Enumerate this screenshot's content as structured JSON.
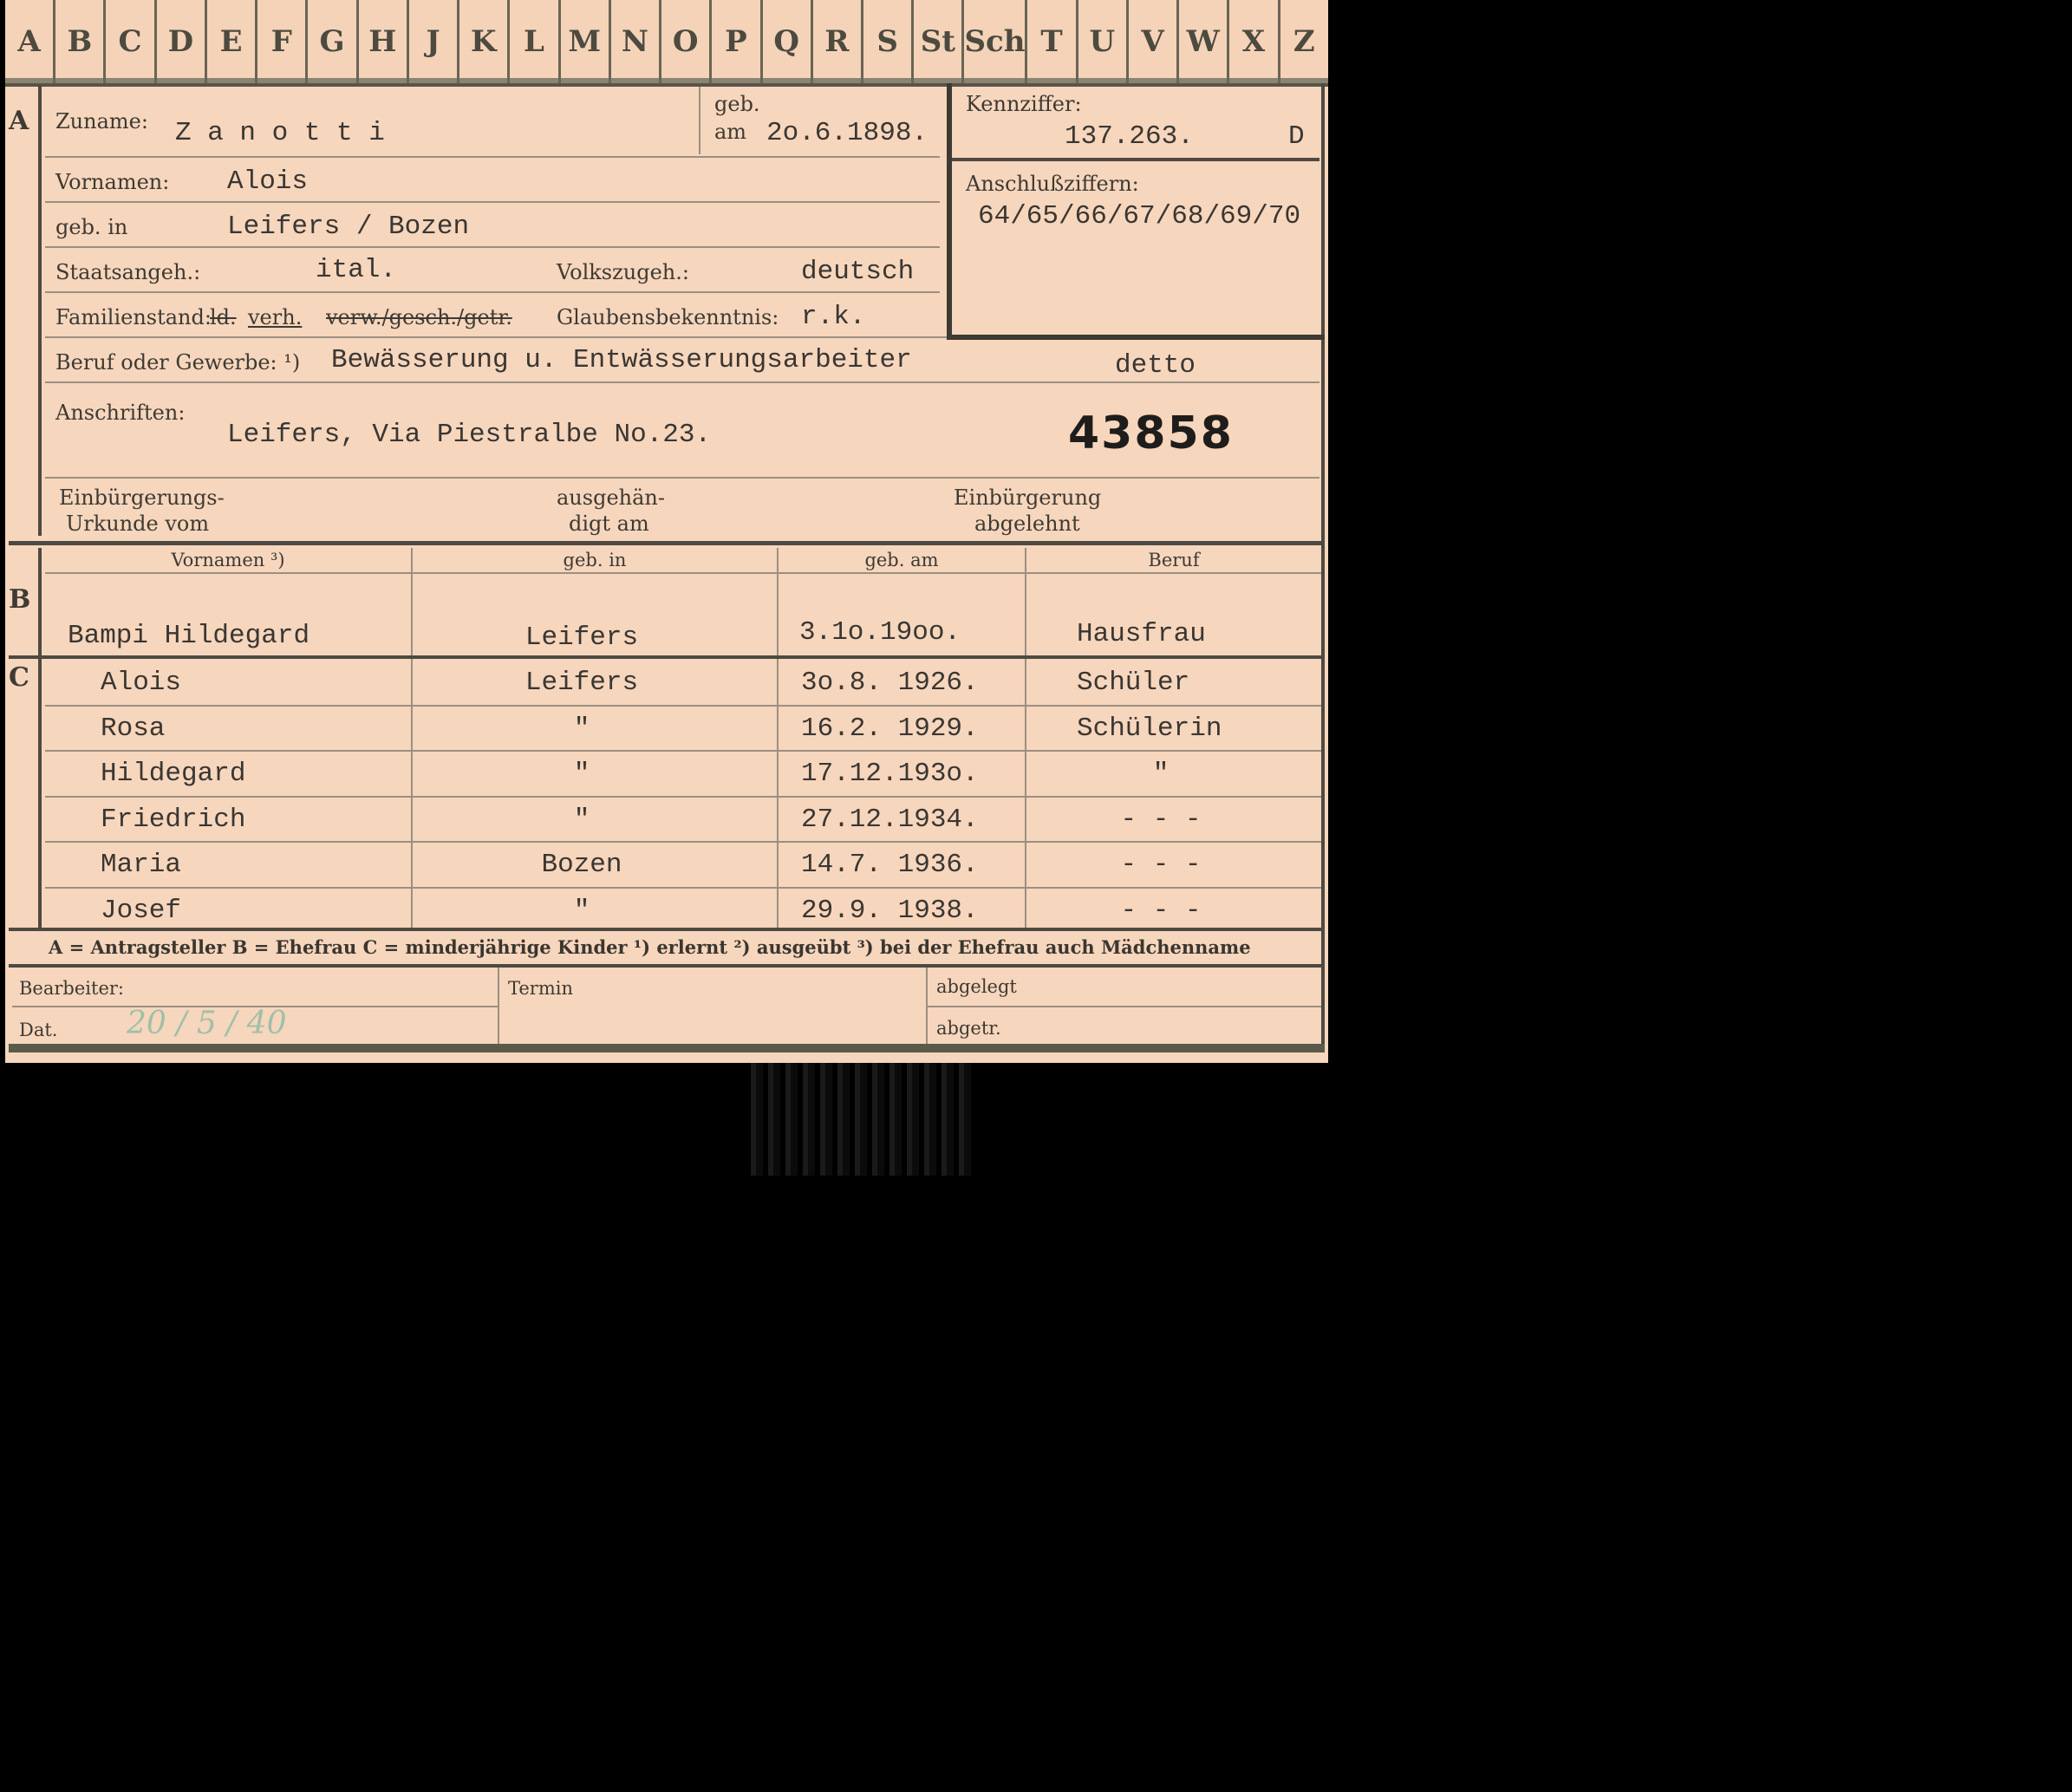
{
  "tabs": [
    "A",
    "B",
    "C",
    "D",
    "E",
    "F",
    "G",
    "H",
    "J",
    "K",
    "L",
    "M",
    "N",
    "O",
    "P",
    "Q",
    "R",
    "S",
    "St",
    "Sch",
    "T",
    "U",
    "V",
    "W",
    "X",
    "Z"
  ],
  "sections": {
    "a": "A",
    "b": "B",
    "c": "C"
  },
  "applicant": {
    "zuname_label": "Zuname:",
    "zuname": "Z a n o t t i",
    "geb_label": "geb.",
    "am_label": "am",
    "geb_am": "2o.6.1898.",
    "vornamen_label": "Vornamen:",
    "vornamen": "Alois",
    "geb_in_label": "geb. in",
    "geb_in": "Leifers / Bozen",
    "staatsangeh_label": "Staatsangeh.:",
    "staatsangeh": "ital.",
    "volkszugeh_label": "Volkszugeh.:",
    "volkszugeh": "deutsch",
    "familienstand_label": "Familienstand:",
    "familienstand_struck_1": "ld.",
    "familienstand_value": "verh.",
    "familienstand_struck_2": "verw./gesch./getr.",
    "glauben_label": "Glaubensbekenntnis:",
    "glauben": "r.k.",
    "beruf_label": "Beruf oder Gewerbe: ¹)",
    "beruf": "Bewässerung u. Entwässerungsarbeiter",
    "beruf_2": "detto",
    "anschriften_label": "Anschriften:",
    "anschrift": "Leifers, Via Piestralbe No.23.",
    "number": "43858",
    "einb_urkunde_label_1": "Einbürgerungs-",
    "einb_urkunde_label_2": "Urkunde vom",
    "ausgehaendigt_label_1": "ausgehän-",
    "ausgehaendigt_label_2": "digt am",
    "einb_abgelehnt_label_1": "Einbürgerung",
    "einb_abgelehnt_label_2": "abgelehnt"
  },
  "kennziffer": {
    "label": "Kennziffer:",
    "value": "137.263.",
    "suffix": "D",
    "anschluss_label": "Anschlußziffern:",
    "anschluss_value": "64/65/66/67/68/69/70"
  },
  "table": {
    "headers": [
      "Vornamen ³)",
      "geb. in",
      "geb. am",
      "Beruf"
    ],
    "wife": {
      "name": "Bampi Hildegard",
      "born_in": "Leifers",
      "born_on": "3.1o.19oo.",
      "job": "Hausfrau"
    },
    "children": [
      {
        "name": "Alois",
        "born_in": "Leifers",
        "born_on": "3o.8. 1926.",
        "job": "Schüler"
      },
      {
        "name": "Rosa",
        "born_in": "\"",
        "born_on": "16.2. 1929.",
        "job": "Schülerin"
      },
      {
        "name": "Hildegard",
        "born_in": "\"",
        "born_on": "17.12.193o.",
        "job": "\""
      },
      {
        "name": "Friedrich",
        "born_in": "\"",
        "born_on": "27.12.1934.",
        "job": "- - -"
      },
      {
        "name": "Maria",
        "born_in": "Bozen",
        "born_on": "14.7. 1936.",
        "job": "- - -"
      },
      {
        "name": "Josef",
        "born_in": "\"",
        "born_on": "29.9. 1938.",
        "job": "- - -"
      }
    ]
  },
  "legend": "A = Antragsteller   B = Ehefrau   C = minderjährige Kinder   ¹) erlernt   ²) ausgeübt   ³) bei der Ehefrau auch Mädchenname",
  "footer": {
    "bearbeiter_label": "Bearbeiter:",
    "dat_label": "Dat.",
    "dat_value": "20 / 5 / 40",
    "termin_label": "Termin",
    "abgelegt_label": "abgelegt",
    "abgetr_label": "abgetr."
  }
}
